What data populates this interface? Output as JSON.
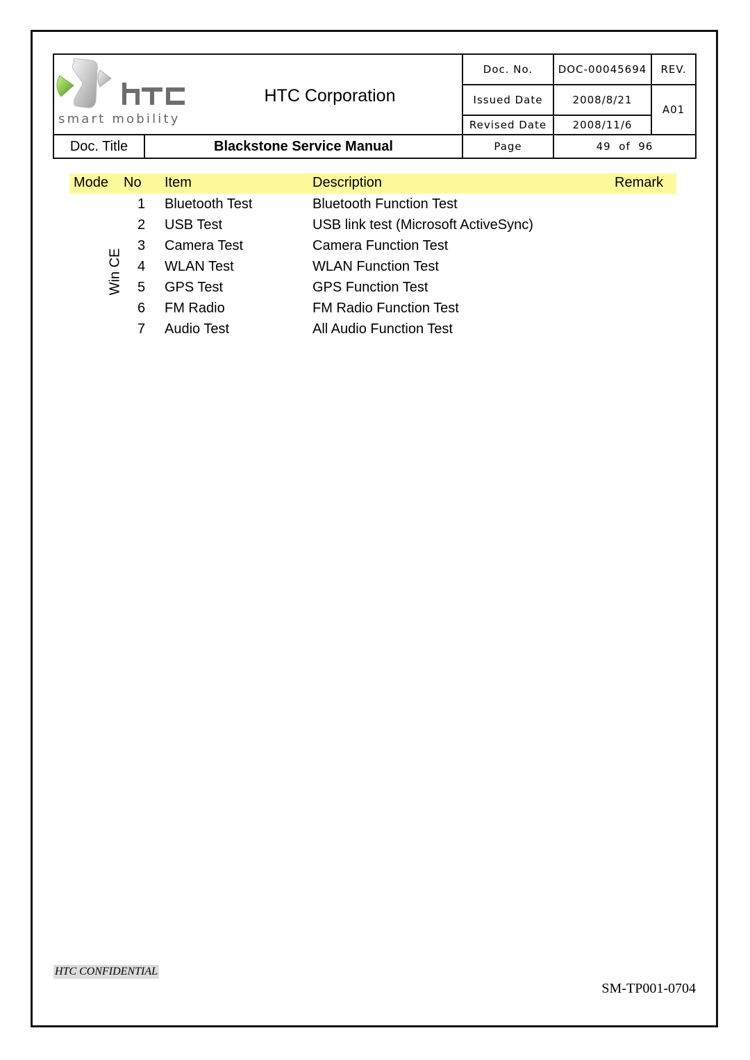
{
  "header": {
    "logo": {
      "brand": "htc",
      "tagline": "smart mobility",
      "icon": "htc-logo-icon"
    },
    "company": "HTC Corporation",
    "doc_no_label": "Doc. No.",
    "doc_no_value": "DOC-00045694",
    "rev_label": "REV.",
    "issued_label": "Issued Date",
    "issued_value": "2008/8/21",
    "revised_label": "Revised Date",
    "revised_value": "2008/11/6",
    "rev_value": "A01",
    "doc_title_label": "Doc. Title",
    "doc_title_value": "Blackstone Service Manual",
    "page_label": "Page",
    "page_value": "49  of  96"
  },
  "table": {
    "header_color": "#fdfa9c",
    "columns": [
      "Mode",
      "No",
      "Item",
      "Description",
      "Remark"
    ],
    "mode": "Win CE",
    "rows": [
      {
        "no": "1",
        "item": "Bluetooth Test",
        "description": "Bluetooth Function Test",
        "remark": ""
      },
      {
        "no": "2",
        "item": "USB Test",
        "description": "USB link test (Microsoft ActiveSync)",
        "remark": ""
      },
      {
        "no": "3",
        "item": "Camera Test",
        "description": "Camera Function Test",
        "remark": ""
      },
      {
        "no": "4",
        "item": "WLAN Test",
        "description": "WLAN Function Test",
        "remark": ""
      },
      {
        "no": "5",
        "item": "GPS Test",
        "description": "GPS Function Test",
        "remark": ""
      },
      {
        "no": "6",
        "item": "FM Radio",
        "description": "FM Radio Function Test",
        "remark": ""
      },
      {
        "no": "7",
        "item": "Audio Test",
        "description": "All Audio Function Test",
        "remark": ""
      }
    ]
  },
  "footer": {
    "confidential": "HTC CONFIDENTIAL",
    "form_no": "SM-TP001-0704"
  }
}
